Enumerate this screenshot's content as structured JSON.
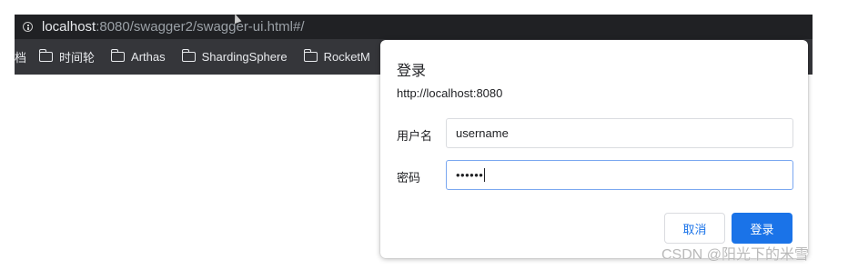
{
  "address_bar": {
    "host": "localhost",
    "rest": ":8080/swagger2/swagger-ui.html#/",
    "icon": "info-icon"
  },
  "bookmarks": {
    "cut_item": "档",
    "items": [
      {
        "label": "时间轮",
        "icon": "folder-icon"
      },
      {
        "label": "Arthas",
        "icon": "folder-icon"
      },
      {
        "label": "ShardingSphere",
        "icon": "folder-icon"
      },
      {
        "label": "RocketM",
        "icon": "folder-icon"
      }
    ]
  },
  "dialog": {
    "title": "登录",
    "origin": "http://localhost:8080",
    "username_label": "用户名",
    "username_value": "username",
    "password_label": "密码",
    "password_value": "••••••",
    "cancel_label": "取消",
    "login_label": "登录"
  },
  "watermark": "CSDN @阳光下的米雪",
  "colors": {
    "primary": "#1a73e8",
    "chrome_dark": "#202124",
    "bookmark_bar": "#35363a",
    "focus_border": "#7aa7f0"
  }
}
